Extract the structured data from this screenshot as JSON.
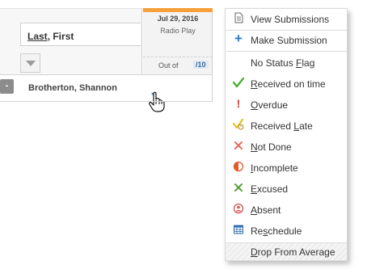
{
  "gradebook": {
    "name_header": {
      "sort_key": "Last",
      "rest": ", First"
    },
    "collapse_label": "-",
    "student_name": "Brotherton, Shannon",
    "assignment": {
      "date": "Jul 29, 2016",
      "title": "Radio Play",
      "out_of_label": "Out of",
      "out_of_value": "/10",
      "accent_color": "#f5a03a"
    }
  },
  "menu": {
    "view_submissions": {
      "label": "View Submissions",
      "icon": "document-icon"
    },
    "make_submission": {
      "label": "Make Submission",
      "icon": "plus-icon"
    },
    "statuses": [
      {
        "pre": "No Status ",
        "key": "F",
        "post": "lag",
        "icon": "none",
        "color": ""
      },
      {
        "pre": "",
        "key": "R",
        "post": "eceived on time",
        "icon": "checkmark-icon",
        "color": "#4caf2e"
      },
      {
        "pre": "",
        "key": "O",
        "post": "verdue",
        "icon": "exclamation-icon",
        "color": "#e53935"
      },
      {
        "pre": "Received ",
        "key": "L",
        "post": "ate",
        "icon": "late-check-icon",
        "color": "#e3c21e"
      },
      {
        "pre": "",
        "key": "N",
        "post": "ot Done",
        "icon": "x-icon",
        "color": "#e86a5e"
      },
      {
        "pre": "",
        "key": "I",
        "post": "ncomplete",
        "icon": "half-circle-icon",
        "color": "#e25a2a"
      },
      {
        "pre": "",
        "key": "E",
        "post": "xcused",
        "icon": "x-icon",
        "color": "#5f9e3a"
      },
      {
        "pre": "",
        "key": "A",
        "post": "bsent",
        "icon": "person-circle-icon",
        "color": "#d9534f"
      },
      {
        "pre": "Re",
        "key": "s",
        "post": "chedule",
        "icon": "calendar-icon",
        "color": "#2f6fb5"
      }
    ],
    "drop_from_average": {
      "pre": "",
      "key": "D",
      "post": "rop From Average"
    }
  }
}
